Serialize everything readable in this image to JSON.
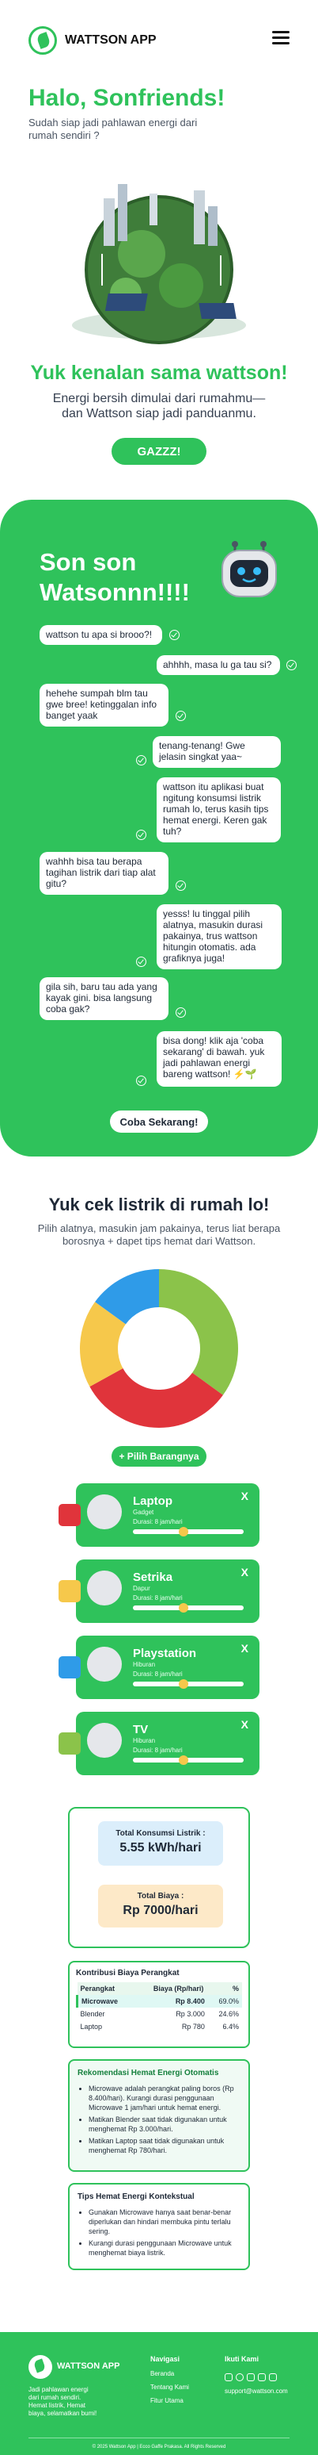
{
  "header": {
    "brand": "WATTSON APP"
  },
  "hero": {
    "greeting": "Halo, Sonfriends!",
    "subtitle": "Sudah siap jadi pahlawan energi dari rumah sendiri ?",
    "intro_title": "Yuk kenalan sama wattson!",
    "intro_text": "Energi bersih dimulai dari rumahmu—dan Wattson siap jadi panduanmu.",
    "cta": "GAZZZ!"
  },
  "chat": {
    "title": "Son son Watsonnn!!!!",
    "messages": [
      {
        "side": "left",
        "text": "wattson tu apa si brooo?!"
      },
      {
        "side": "right",
        "text": "ahhhh, masa lu ga tau si?"
      },
      {
        "side": "left",
        "text": "hehehe sumpah blm tau gwe bree! ketinggalan info banget yaak"
      },
      {
        "side": "right",
        "text": "tenang-tenang! Gwe jelasin singkat yaa~"
      },
      {
        "side": "right",
        "text": "wattson itu aplikasi buat ngitung konsumsi listrik rumah lo, terus kasih tips hemat energi. Keren gak tuh?"
      },
      {
        "side": "left",
        "text": "wahhh bisa tau berapa tagihan listrik dari tiap alat gitu?"
      },
      {
        "side": "right",
        "text": "yesss! lu tinggal pilih alatnya, masukin durasi pakainya, trus wattson hitungin otomatis. ada grafiknya juga!"
      },
      {
        "side": "left",
        "text": "gila sih, baru tau ada yang kayak gini. bisa langsung coba gak?"
      },
      {
        "side": "right",
        "text": "bisa dong! klik aja 'coba sekarang' di bawah. yuk jadi pahlawan energi bareng wattson! ⚡🌱"
      }
    ],
    "cta": "Coba Sekarang!"
  },
  "check": {
    "title": "Yuk cek listrik di rumah lo!",
    "subtitle": "Pilih alatnya, masukin jam pakainya, terus liat berapa borosnya + dapet tips hemat dari Wattson.",
    "pick_button": "+ Pilih Barangnya"
  },
  "chart_data": {
    "type": "pie",
    "donut": true,
    "series": [
      {
        "name": "Laptop",
        "value": 6.4,
        "color": "#e0343b"
      },
      {
        "name": "Setrika",
        "value": 0,
        "color": "#f6c84b"
      },
      {
        "name": "Playstation",
        "value": 0,
        "color": "#2f9be8"
      },
      {
        "name": "TV",
        "value": 0,
        "color": "#8bc34a"
      }
    ],
    "slices": [
      {
        "label": "",
        "value": 35,
        "color": "#8bc34a"
      },
      {
        "label": "",
        "value": 32,
        "color": "#e0343b"
      },
      {
        "label": "",
        "value": 18,
        "color": "#f6c84b"
      },
      {
        "label": "",
        "value": 15,
        "color": "#2f9be8"
      }
    ]
  },
  "devices": [
    {
      "name": "Laptop",
      "category": "Gadget",
      "duration": "Durasi: 8 jam/hari",
      "level": 0.45,
      "color": "#e0343b"
    },
    {
      "name": "Setrika",
      "category": "Dapur",
      "duration": "Durasi: 8 jam/hari",
      "level": 0.45,
      "color": "#f6c84b"
    },
    {
      "name": "Playstation",
      "category": "Hiburan",
      "duration": "Durasi: 8 jam/hari",
      "level": 0.45,
      "color": "#2f9be8"
    },
    {
      "name": "TV",
      "category": "Hiburan",
      "duration": "Durasi: 8 jam/hari",
      "level": 0.45,
      "color": "#8bc34a"
    }
  ],
  "summary": {
    "consumption_label": "Total Konsumsi Listrik :",
    "consumption_value": "5.55 kWh/hari",
    "cost_label": "Total Biaya :",
    "cost_value": "Rp 7000/hari"
  },
  "contribution": {
    "title": "Kontribusi Biaya Perangkat",
    "headers": [
      "Perangkat",
      "Biaya (Rp/hari)",
      "%"
    ],
    "rows": [
      [
        "Microwave",
        "Rp 8.400",
        "69.0%"
      ],
      [
        "Blender",
        "Rp 3.000",
        "24.6%"
      ],
      [
        "Laptop",
        "Rp 780",
        "6.4%"
      ]
    ]
  },
  "recommendation": {
    "title": "Rekomendasi Hemat Energi Otomatis",
    "items": [
      "Microwave adalah perangkat paling boros (Rp 8.400/hari). Kurangi durasi penggunaan Microwave 1 jam/hari untuk hemat energi.",
      "Matikan Blender saat tidak digunakan untuk menghemat Rp 3.000/hari.",
      "Matikan Laptop saat tidak digunakan untuk menghemat Rp 780/hari."
    ]
  },
  "tips": {
    "title": "Tips Hemat Energi Kontekstual",
    "items": [
      "Gunakan Microwave hanya saat benar-benar diperlukan dan hindari membuka pintu terlalu sering.",
      "Kurangi durasi penggunaan Microwave untuk menghemat biaya listrik."
    ]
  },
  "footer": {
    "brand": "WATTSON APP",
    "tagline": "Jadi pahlawan energi dari rumah sendiri. Hemat listrik, Hemat biaya, selamatkan bumi!",
    "nav_title": "Navigasi",
    "nav_items": [
      "Beranda",
      "Tentang Kami",
      "Fitur Utama"
    ],
    "contact_title": "Ikuti Kami",
    "email": "support@wattson.com",
    "copyright": "© 2025 Wattson App | Ecco Gaffe Prakasa. All Rights Reserved"
  }
}
